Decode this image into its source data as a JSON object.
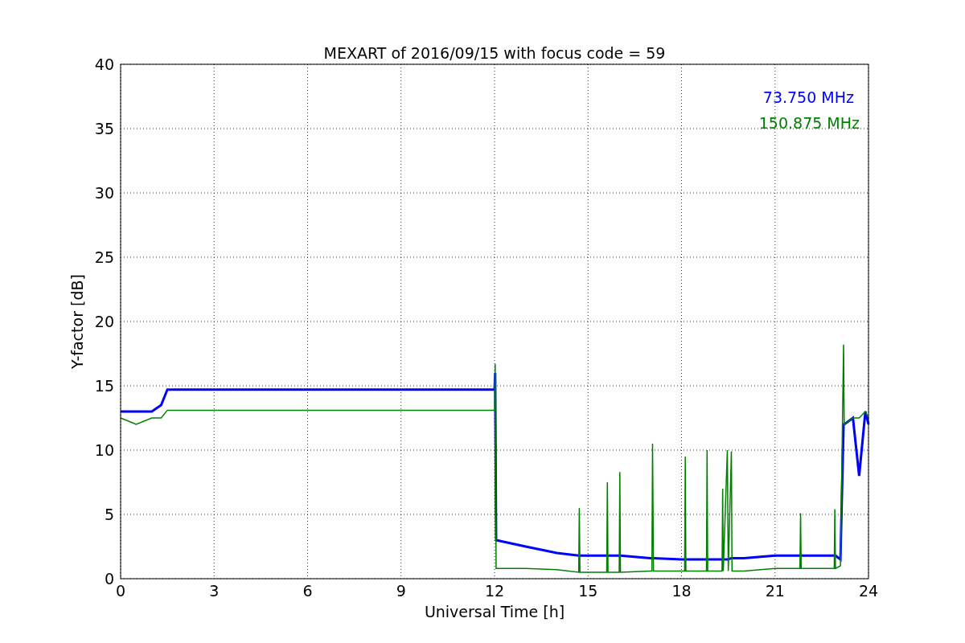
{
  "chart_data": {
    "type": "line",
    "grid": true,
    "title": "MEXART of 2016/09/15 with focus code = 59",
    "xlabel": "Universal Time [h]",
    "ylabel": "Y-factor [dB]",
    "xlim": [
      0,
      24
    ],
    "ylim": [
      0,
      40
    ],
    "xticks": [
      0,
      3,
      6,
      9,
      12,
      15,
      18,
      21,
      24
    ],
    "yticks": [
      0,
      5,
      10,
      15,
      20,
      25,
      30,
      35,
      40
    ],
    "x": [
      0,
      0.5,
      1,
      1.3,
      1.5,
      12,
      12.02,
      12.05,
      13,
      14,
      14.7,
      14.72,
      14.74,
      15.6,
      15.62,
      15.64,
      16,
      16.02,
      16.04,
      17,
      17.05,
      17.07,
      17.1,
      18,
      18.1,
      18.12,
      18.14,
      18.8,
      18.82,
      18.84,
      19.3,
      19.32,
      19.34,
      19.47,
      19.5,
      19.6,
      19.62,
      20,
      21,
      21.8,
      21.82,
      21.84,
      22.9,
      22.92,
      22.94,
      23.1,
      23.2,
      23.22,
      23.5,
      23.7,
      23.9,
      24
    ],
    "series": [
      {
        "name": "73.750 MHz",
        "color": "#0000ff",
        "values": [
          13,
          13,
          13,
          13.5,
          14.7,
          14.7,
          16,
          3,
          2.5,
          2,
          1.8,
          1.8,
          1.8,
          1.8,
          1.8,
          1.8,
          1.8,
          1.8,
          1.8,
          1.6,
          1.6,
          1.6,
          1.6,
          1.5,
          1.5,
          1.5,
          1.5,
          1.5,
          1.5,
          1.5,
          1.5,
          1.5,
          1.5,
          1.5,
          1.5,
          1.6,
          1.6,
          1.6,
          1.8,
          1.8,
          1.8,
          1.8,
          1.8,
          1.8,
          1.8,
          1.5,
          12,
          12,
          12.5,
          8,
          13,
          12
        ]
      },
      {
        "name": "150.875 MHz",
        "color": "#008000",
        "values": [
          12.5,
          12,
          12.5,
          12.5,
          13.1,
          13.1,
          16.7,
          0.8,
          0.8,
          0.7,
          0.5,
          5.5,
          0.5,
          0.5,
          7.5,
          0.5,
          0.5,
          8.3,
          0.5,
          0.6,
          0.6,
          10.5,
          0.6,
          0.6,
          0.6,
          9.5,
          0.6,
          0.6,
          10,
          0.6,
          0.6,
          7,
          0.6,
          10,
          0.6,
          9.9,
          0.6,
          0.6,
          0.8,
          0.8,
          5.1,
          0.8,
          0.8,
          5.4,
          0.8,
          1,
          18.2,
          12,
          12.5,
          12.5,
          13,
          12.5
        ]
      }
    ]
  }
}
